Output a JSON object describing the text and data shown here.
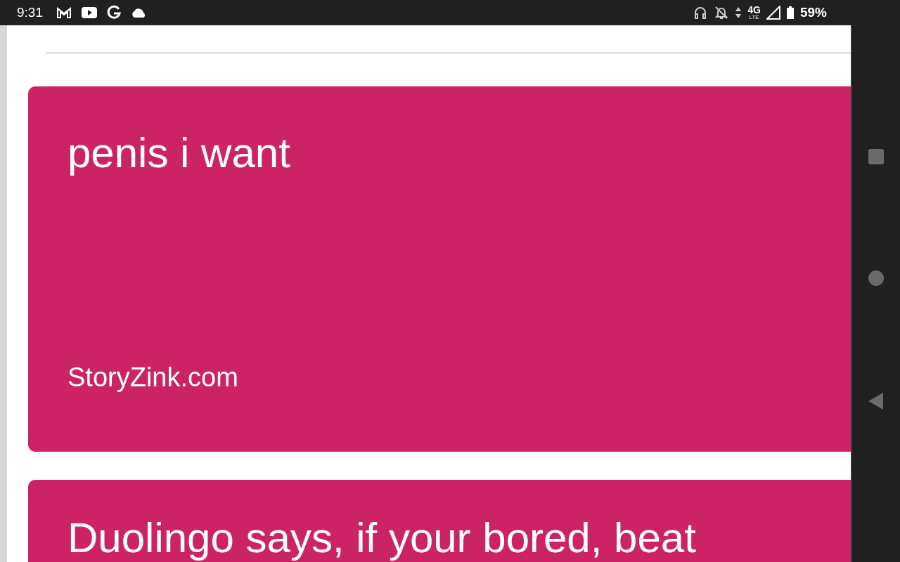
{
  "status_bar": {
    "time": "9:31",
    "battery": "59%",
    "network": "4G",
    "network_sub": "LTE"
  },
  "cards": [
    {
      "title": "penis i want",
      "source": "StoryZink.com",
      "color": "#cc2366"
    },
    {
      "title": "Duolingo says, if your bored, beat",
      "color": "#cc2366"
    }
  ]
}
